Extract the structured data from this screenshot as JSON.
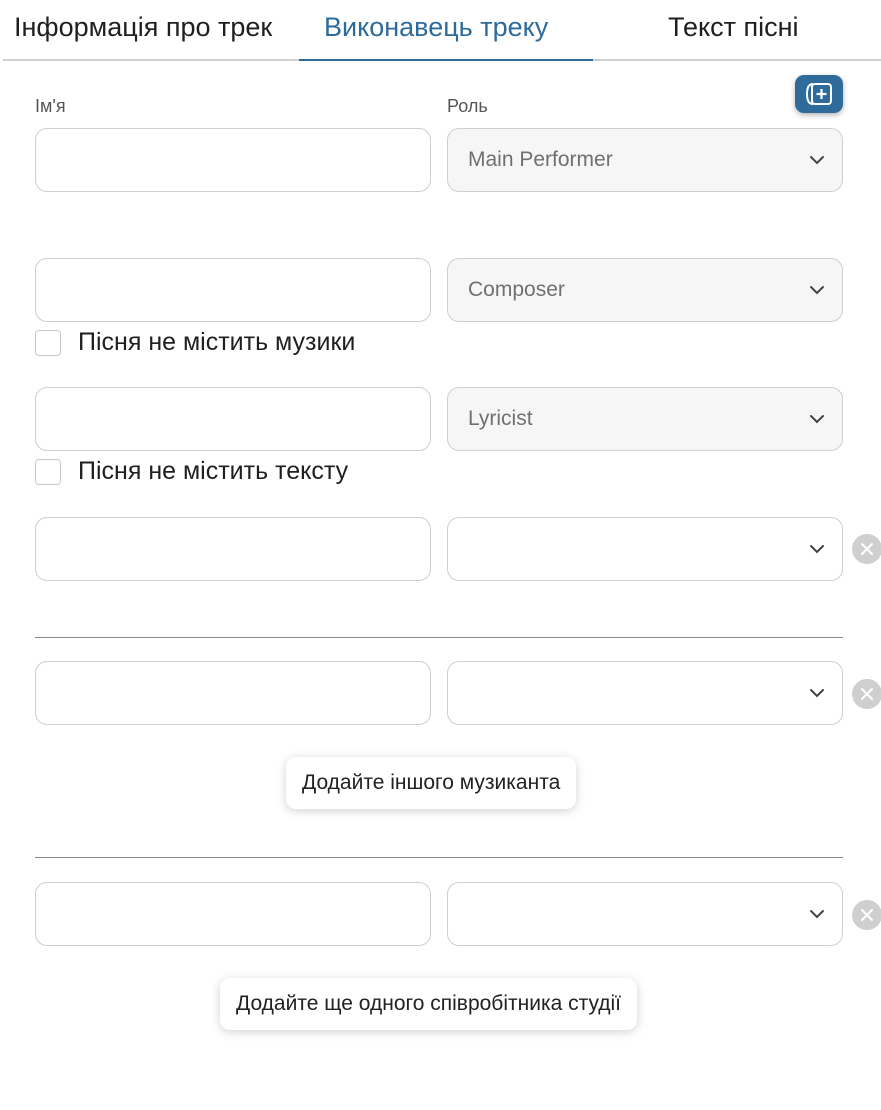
{
  "tabs": [
    {
      "label": "Інформація про трек",
      "active": false
    },
    {
      "label": "Виконавець треку",
      "active": true
    },
    {
      "label": "Текст пісні",
      "active": false
    }
  ],
  "labels": {
    "name": "Ім'я",
    "role": "Роль"
  },
  "rows": [
    {
      "name": "",
      "role": "Main Performer"
    },
    {
      "name": "",
      "role": "Composer"
    },
    {
      "name": "",
      "role": "Lyricist"
    },
    {
      "name": "",
      "role": ""
    },
    {
      "name": "",
      "role": ""
    },
    {
      "name": "",
      "role": ""
    }
  ],
  "checkboxes": {
    "no_music": {
      "label": "Пісня не містить музики",
      "checked": false
    },
    "no_lyrics": {
      "label": "Пісня не містить тексту",
      "checked": false
    }
  },
  "buttons": {
    "add_musician": "Додайте іншого музиканта",
    "add_studio_staff": "Додайте ще одного співробітника студії"
  },
  "icons": {
    "add_row": "add-row-icon",
    "chevron": "chevron-down-icon",
    "remove": "close-icon"
  },
  "colors": {
    "accent": "#2e6b9b",
    "remove": "#cfcfcf"
  }
}
